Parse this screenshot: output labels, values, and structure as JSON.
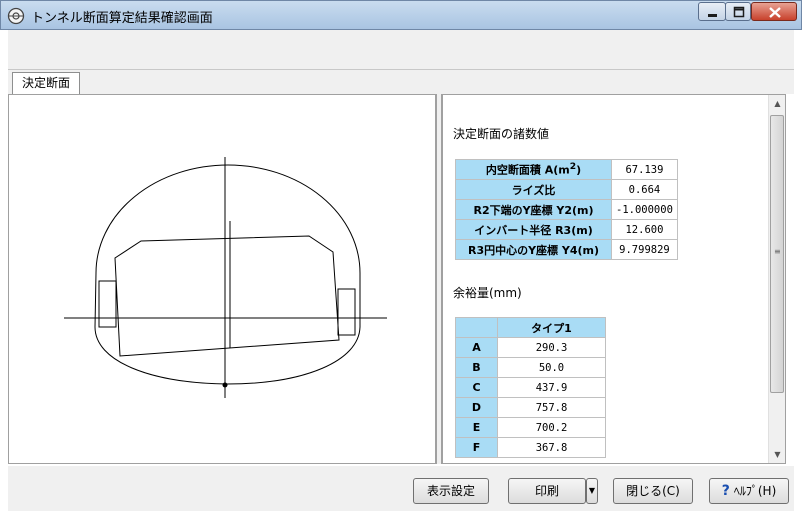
{
  "window": {
    "title": "トンネル断面算定結果確認画面"
  },
  "tabs": [
    {
      "label": "決定断面"
    }
  ],
  "info": {
    "heading": "決定断面の諸数値",
    "props": [
      {
        "label": "内空断面積 A(m²)",
        "value": "67.139"
      },
      {
        "label": "ライズ比",
        "value": "0.664"
      },
      {
        "label": "R2下端のY座標 Y2(m)",
        "value": "-1.000000"
      },
      {
        "label": "インバート半径 R3(m)",
        "value": "12.600"
      },
      {
        "label": "R3円中心のY座標 Y4(m)",
        "value": "9.799829"
      }
    ],
    "margin_heading": "余裕量(mm)",
    "margin_column": "タイプ1",
    "margin_rows": [
      {
        "label": "A",
        "value": "290.3"
      },
      {
        "label": "B",
        "value": "50.0"
      },
      {
        "label": "C",
        "value": "437.9"
      },
      {
        "label": "D",
        "value": "757.8"
      },
      {
        "label": "E",
        "value": "700.2"
      },
      {
        "label": "F",
        "value": "367.8"
      }
    ]
  },
  "buttons": {
    "display_settings": "表示設定",
    "print": "印刷",
    "close": "閉じる(C)",
    "help": "ﾍﾙﾌﾟ(H)"
  },
  "colors": {
    "header_cell": "#a9dcf5",
    "titlebar": "#b9d1ea"
  }
}
